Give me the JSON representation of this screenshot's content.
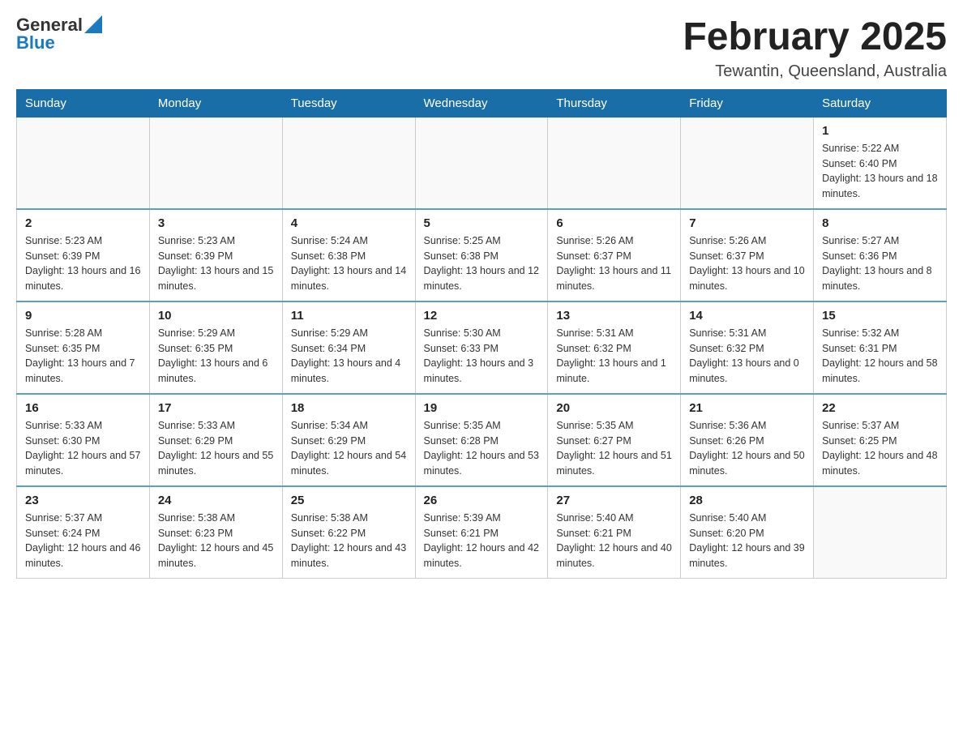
{
  "header": {
    "logo": {
      "general": "General",
      "arrow": "▲",
      "blue": "Blue"
    },
    "title": "February 2025",
    "location": "Tewantin, Queensland, Australia"
  },
  "weekdays": [
    "Sunday",
    "Monday",
    "Tuesday",
    "Wednesday",
    "Thursday",
    "Friday",
    "Saturday"
  ],
  "weeks": [
    [
      {
        "day": "",
        "info": ""
      },
      {
        "day": "",
        "info": ""
      },
      {
        "day": "",
        "info": ""
      },
      {
        "day": "",
        "info": ""
      },
      {
        "day": "",
        "info": ""
      },
      {
        "day": "",
        "info": ""
      },
      {
        "day": "1",
        "info": "Sunrise: 5:22 AM\nSunset: 6:40 PM\nDaylight: 13 hours and 18 minutes."
      }
    ],
    [
      {
        "day": "2",
        "info": "Sunrise: 5:23 AM\nSunset: 6:39 PM\nDaylight: 13 hours and 16 minutes."
      },
      {
        "day": "3",
        "info": "Sunrise: 5:23 AM\nSunset: 6:39 PM\nDaylight: 13 hours and 15 minutes."
      },
      {
        "day": "4",
        "info": "Sunrise: 5:24 AM\nSunset: 6:38 PM\nDaylight: 13 hours and 14 minutes."
      },
      {
        "day": "5",
        "info": "Sunrise: 5:25 AM\nSunset: 6:38 PM\nDaylight: 13 hours and 12 minutes."
      },
      {
        "day": "6",
        "info": "Sunrise: 5:26 AM\nSunset: 6:37 PM\nDaylight: 13 hours and 11 minutes."
      },
      {
        "day": "7",
        "info": "Sunrise: 5:26 AM\nSunset: 6:37 PM\nDaylight: 13 hours and 10 minutes."
      },
      {
        "day": "8",
        "info": "Sunrise: 5:27 AM\nSunset: 6:36 PM\nDaylight: 13 hours and 8 minutes."
      }
    ],
    [
      {
        "day": "9",
        "info": "Sunrise: 5:28 AM\nSunset: 6:35 PM\nDaylight: 13 hours and 7 minutes."
      },
      {
        "day": "10",
        "info": "Sunrise: 5:29 AM\nSunset: 6:35 PM\nDaylight: 13 hours and 6 minutes."
      },
      {
        "day": "11",
        "info": "Sunrise: 5:29 AM\nSunset: 6:34 PM\nDaylight: 13 hours and 4 minutes."
      },
      {
        "day": "12",
        "info": "Sunrise: 5:30 AM\nSunset: 6:33 PM\nDaylight: 13 hours and 3 minutes."
      },
      {
        "day": "13",
        "info": "Sunrise: 5:31 AM\nSunset: 6:32 PM\nDaylight: 13 hours and 1 minute."
      },
      {
        "day": "14",
        "info": "Sunrise: 5:31 AM\nSunset: 6:32 PM\nDaylight: 13 hours and 0 minutes."
      },
      {
        "day": "15",
        "info": "Sunrise: 5:32 AM\nSunset: 6:31 PM\nDaylight: 12 hours and 58 minutes."
      }
    ],
    [
      {
        "day": "16",
        "info": "Sunrise: 5:33 AM\nSunset: 6:30 PM\nDaylight: 12 hours and 57 minutes."
      },
      {
        "day": "17",
        "info": "Sunrise: 5:33 AM\nSunset: 6:29 PM\nDaylight: 12 hours and 55 minutes."
      },
      {
        "day": "18",
        "info": "Sunrise: 5:34 AM\nSunset: 6:29 PM\nDaylight: 12 hours and 54 minutes."
      },
      {
        "day": "19",
        "info": "Sunrise: 5:35 AM\nSunset: 6:28 PM\nDaylight: 12 hours and 53 minutes."
      },
      {
        "day": "20",
        "info": "Sunrise: 5:35 AM\nSunset: 6:27 PM\nDaylight: 12 hours and 51 minutes."
      },
      {
        "day": "21",
        "info": "Sunrise: 5:36 AM\nSunset: 6:26 PM\nDaylight: 12 hours and 50 minutes."
      },
      {
        "day": "22",
        "info": "Sunrise: 5:37 AM\nSunset: 6:25 PM\nDaylight: 12 hours and 48 minutes."
      }
    ],
    [
      {
        "day": "23",
        "info": "Sunrise: 5:37 AM\nSunset: 6:24 PM\nDaylight: 12 hours and 46 minutes."
      },
      {
        "day": "24",
        "info": "Sunrise: 5:38 AM\nSunset: 6:23 PM\nDaylight: 12 hours and 45 minutes."
      },
      {
        "day": "25",
        "info": "Sunrise: 5:38 AM\nSunset: 6:22 PM\nDaylight: 12 hours and 43 minutes."
      },
      {
        "day": "26",
        "info": "Sunrise: 5:39 AM\nSunset: 6:21 PM\nDaylight: 12 hours and 42 minutes."
      },
      {
        "day": "27",
        "info": "Sunrise: 5:40 AM\nSunset: 6:21 PM\nDaylight: 12 hours and 40 minutes."
      },
      {
        "day": "28",
        "info": "Sunrise: 5:40 AM\nSunset: 6:20 PM\nDaylight: 12 hours and 39 minutes."
      },
      {
        "day": "",
        "info": ""
      }
    ]
  ]
}
